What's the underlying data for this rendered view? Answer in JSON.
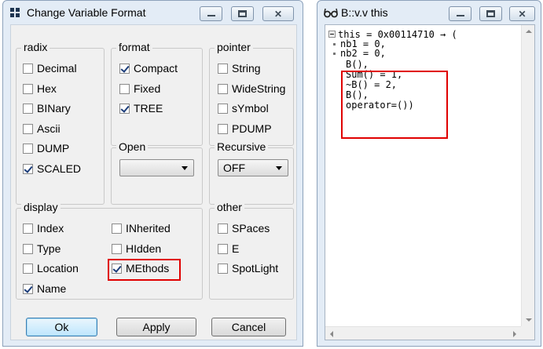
{
  "dialog": {
    "title": "Change Variable Format",
    "title_icon": "grid-icon",
    "radix": {
      "label": "radix",
      "options": [
        {
          "label": "Decimal",
          "checked": false
        },
        {
          "label": "Hex",
          "checked": false
        },
        {
          "label": "BINary",
          "checked": false
        },
        {
          "label": "Ascii",
          "checked": false
        },
        {
          "label": "DUMP",
          "checked": false
        },
        {
          "label": "SCALED",
          "checked": true
        }
      ]
    },
    "format": {
      "label": "format",
      "options": [
        {
          "label": "Compact",
          "checked": true
        },
        {
          "label": "Fixed",
          "checked": false
        },
        {
          "label": "TREE",
          "checked": true
        }
      ]
    },
    "pointer": {
      "label": "pointer",
      "options": [
        {
          "label": "String",
          "checked": false
        },
        {
          "label": "WideString",
          "checked": false
        },
        {
          "label": "sYmbol",
          "checked": false
        },
        {
          "label": "PDUMP",
          "checked": false
        }
      ]
    },
    "open": {
      "label": "Open",
      "value": ""
    },
    "recursive": {
      "label": "Recursive",
      "value": "OFF"
    },
    "display": {
      "label": "display",
      "options": [
        {
          "label": "Index",
          "checked": false
        },
        {
          "label": "Type",
          "checked": false
        },
        {
          "label": "Location",
          "checked": false
        },
        {
          "label": "Name",
          "checked": true
        },
        {
          "label": "INherited",
          "checked": false
        },
        {
          "label": "HIdden",
          "checked": false
        },
        {
          "label": "MEthods",
          "checked": true
        }
      ]
    },
    "other": {
      "label": "other",
      "options": [
        {
          "label": "SPaces",
          "checked": false
        },
        {
          "label": "E",
          "checked": false
        },
        {
          "label": "SpotLight",
          "checked": false
        }
      ]
    },
    "buttons": {
      "ok": "Ok",
      "apply": "Apply",
      "cancel": "Cancel"
    },
    "highlight_color": "#e00000"
  },
  "variable_window": {
    "title": "B::v.v this",
    "title_icon": "glasses-icon",
    "lines": [
      "this = 0x00114710 → (",
      "nb1 = 0,",
      "nb2 = 0,",
      "B(),",
      "Sum() = 1,",
      "~B() = 2,",
      "B(),",
      "operator=())"
    ]
  }
}
